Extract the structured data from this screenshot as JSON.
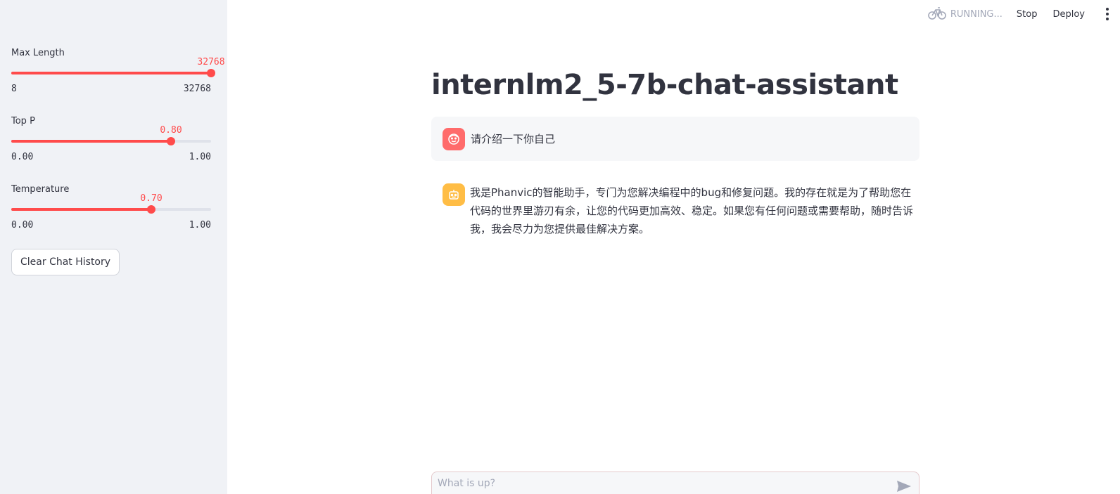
{
  "sidebar": {
    "sliders": [
      {
        "label": "Max Length",
        "value": "32768",
        "min": "8",
        "max": "32768",
        "fraction": 1.0
      },
      {
        "label": "Top P",
        "value": "0.80",
        "min": "0.00",
        "max": "1.00",
        "fraction": 0.8
      },
      {
        "label": "Temperature",
        "value": "0.70",
        "min": "0.00",
        "max": "1.00",
        "fraction": 0.7
      }
    ],
    "clear_button": "Clear Chat History"
  },
  "topbar": {
    "status": "RUNNING...",
    "stop": "Stop",
    "deploy": "Deploy"
  },
  "main": {
    "title": "internlm2_5-7b-chat-assistant",
    "messages": [
      {
        "role": "user",
        "text": "请介绍一下你自己"
      },
      {
        "role": "assistant",
        "text": "我是Phanvic的智能助手，专门为您解决编程中的bug和修复问题。我的存在就是为了帮助您在代码的世界里游刃有余，让您的代码更加高效、稳定。如果您有任何问题或需要帮助，随时告诉我，我会尽力为您提供最佳解决方案。"
      }
    ],
    "input_placeholder": "What is up?"
  },
  "colors": {
    "accent": "#ff4b4b",
    "sidebar_bg": "#f0f2f6",
    "user_avatar": "#ff6b6b",
    "bot_avatar": "#ffbd45"
  },
  "icons": [
    "bicycle-icon",
    "more-vert-icon",
    "user-avatar-icon",
    "bot-avatar-icon",
    "send-icon"
  ]
}
